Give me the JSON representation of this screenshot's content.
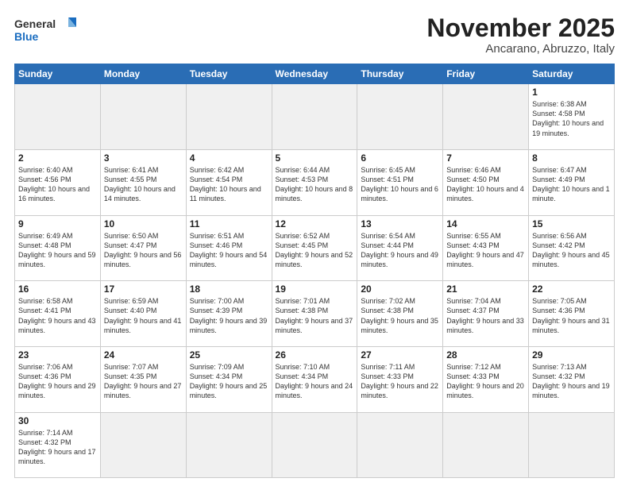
{
  "header": {
    "logo_general": "General",
    "logo_blue": "Blue",
    "month_title": "November 2025",
    "location": "Ancarano, Abruzzo, Italy"
  },
  "weekdays": [
    "Sunday",
    "Monday",
    "Tuesday",
    "Wednesday",
    "Thursday",
    "Friday",
    "Saturday"
  ],
  "weeks": [
    [
      {
        "day": "",
        "info": ""
      },
      {
        "day": "",
        "info": ""
      },
      {
        "day": "",
        "info": ""
      },
      {
        "day": "",
        "info": ""
      },
      {
        "day": "",
        "info": ""
      },
      {
        "day": "",
        "info": ""
      },
      {
        "day": "1",
        "info": "Sunrise: 6:38 AM\nSunset: 4:58 PM\nDaylight: 10 hours and 19 minutes."
      }
    ],
    [
      {
        "day": "2",
        "info": "Sunrise: 6:40 AM\nSunset: 4:56 PM\nDaylight: 10 hours and 16 minutes."
      },
      {
        "day": "3",
        "info": "Sunrise: 6:41 AM\nSunset: 4:55 PM\nDaylight: 10 hours and 14 minutes."
      },
      {
        "day": "4",
        "info": "Sunrise: 6:42 AM\nSunset: 4:54 PM\nDaylight: 10 hours and 11 minutes."
      },
      {
        "day": "5",
        "info": "Sunrise: 6:44 AM\nSunset: 4:53 PM\nDaylight: 10 hours and 8 minutes."
      },
      {
        "day": "6",
        "info": "Sunrise: 6:45 AM\nSunset: 4:51 PM\nDaylight: 10 hours and 6 minutes."
      },
      {
        "day": "7",
        "info": "Sunrise: 6:46 AM\nSunset: 4:50 PM\nDaylight: 10 hours and 4 minutes."
      },
      {
        "day": "8",
        "info": "Sunrise: 6:47 AM\nSunset: 4:49 PM\nDaylight: 10 hours and 1 minute."
      }
    ],
    [
      {
        "day": "9",
        "info": "Sunrise: 6:49 AM\nSunset: 4:48 PM\nDaylight: 9 hours and 59 minutes."
      },
      {
        "day": "10",
        "info": "Sunrise: 6:50 AM\nSunset: 4:47 PM\nDaylight: 9 hours and 56 minutes."
      },
      {
        "day": "11",
        "info": "Sunrise: 6:51 AM\nSunset: 4:46 PM\nDaylight: 9 hours and 54 minutes."
      },
      {
        "day": "12",
        "info": "Sunrise: 6:52 AM\nSunset: 4:45 PM\nDaylight: 9 hours and 52 minutes."
      },
      {
        "day": "13",
        "info": "Sunrise: 6:54 AM\nSunset: 4:44 PM\nDaylight: 9 hours and 49 minutes."
      },
      {
        "day": "14",
        "info": "Sunrise: 6:55 AM\nSunset: 4:43 PM\nDaylight: 9 hours and 47 minutes."
      },
      {
        "day": "15",
        "info": "Sunrise: 6:56 AM\nSunset: 4:42 PM\nDaylight: 9 hours and 45 minutes."
      }
    ],
    [
      {
        "day": "16",
        "info": "Sunrise: 6:58 AM\nSunset: 4:41 PM\nDaylight: 9 hours and 43 minutes."
      },
      {
        "day": "17",
        "info": "Sunrise: 6:59 AM\nSunset: 4:40 PM\nDaylight: 9 hours and 41 minutes."
      },
      {
        "day": "18",
        "info": "Sunrise: 7:00 AM\nSunset: 4:39 PM\nDaylight: 9 hours and 39 minutes."
      },
      {
        "day": "19",
        "info": "Sunrise: 7:01 AM\nSunset: 4:38 PM\nDaylight: 9 hours and 37 minutes."
      },
      {
        "day": "20",
        "info": "Sunrise: 7:02 AM\nSunset: 4:38 PM\nDaylight: 9 hours and 35 minutes."
      },
      {
        "day": "21",
        "info": "Sunrise: 7:04 AM\nSunset: 4:37 PM\nDaylight: 9 hours and 33 minutes."
      },
      {
        "day": "22",
        "info": "Sunrise: 7:05 AM\nSunset: 4:36 PM\nDaylight: 9 hours and 31 minutes."
      }
    ],
    [
      {
        "day": "23",
        "info": "Sunrise: 7:06 AM\nSunset: 4:36 PM\nDaylight: 9 hours and 29 minutes."
      },
      {
        "day": "24",
        "info": "Sunrise: 7:07 AM\nSunset: 4:35 PM\nDaylight: 9 hours and 27 minutes."
      },
      {
        "day": "25",
        "info": "Sunrise: 7:09 AM\nSunset: 4:34 PM\nDaylight: 9 hours and 25 minutes."
      },
      {
        "day": "26",
        "info": "Sunrise: 7:10 AM\nSunset: 4:34 PM\nDaylight: 9 hours and 24 minutes."
      },
      {
        "day": "27",
        "info": "Sunrise: 7:11 AM\nSunset: 4:33 PM\nDaylight: 9 hours and 22 minutes."
      },
      {
        "day": "28",
        "info": "Sunrise: 7:12 AM\nSunset: 4:33 PM\nDaylight: 9 hours and 20 minutes."
      },
      {
        "day": "29",
        "info": "Sunrise: 7:13 AM\nSunset: 4:32 PM\nDaylight: 9 hours and 19 minutes."
      }
    ],
    [
      {
        "day": "30",
        "info": "Sunrise: 7:14 AM\nSunset: 4:32 PM\nDaylight: 9 hours and 17 minutes."
      },
      {
        "day": "",
        "info": ""
      },
      {
        "day": "",
        "info": ""
      },
      {
        "day": "",
        "info": ""
      },
      {
        "day": "",
        "info": ""
      },
      {
        "day": "",
        "info": ""
      },
      {
        "day": "",
        "info": ""
      }
    ]
  ]
}
